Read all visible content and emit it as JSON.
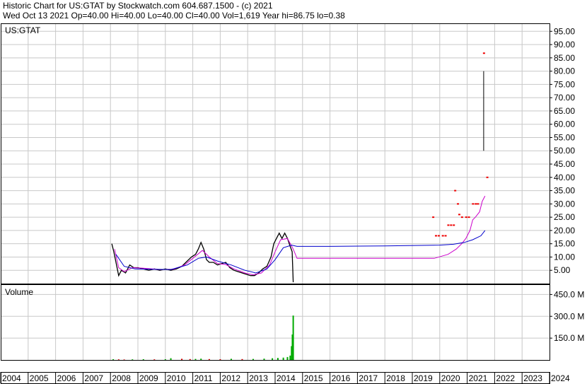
{
  "header": {
    "line1": "Historic Chart for US:GTAT by Stockwatch.com 604.687.1500 - (c) 2021",
    "line2": "Wed Oct 13 2021   Op=40.00   Hi=40.00   Lo=40.00   Cl=40.00   Vol=1,619   Year hi=86.75   lo=0.38"
  },
  "colors": {
    "price": "#000000",
    "price_dots": "#ee0000",
    "ma_short": "#cc00cc",
    "ma_long": "#0000cc",
    "vol_up": "#00aa00",
    "vol_down": "#dd0000",
    "grid": "#c8c8c8"
  },
  "chart_data": [
    {
      "type": "line",
      "panel": "price",
      "title": "US:GTAT",
      "yticks": [
        "5.00",
        "10.00",
        "15.00",
        "20.00",
        "25.00",
        "30.00",
        "35.00",
        "40.00",
        "45.00",
        "50.00",
        "55.00",
        "60.00",
        "65.00",
        "70.00",
        "75.00",
        "80.00",
        "85.00",
        "90.00",
        "95.00"
      ],
      "ylim": [
        0,
        98
      ],
      "xlim": [
        2004.0,
        2024.0
      ],
      "grid": true,
      "series": [
        {
          "role": "price",
          "points": [
            [
              2008.05,
              15
            ],
            [
              2008.12,
              12
            ],
            [
              2008.2,
              8
            ],
            [
              2008.3,
              3
            ],
            [
              2008.4,
              5
            ],
            [
              2008.55,
              4
            ],
            [
              2008.7,
              7
            ],
            [
              2008.85,
              6
            ],
            [
              2009.0,
              6
            ],
            [
              2009.2,
              5.5
            ],
            [
              2009.4,
              5
            ],
            [
              2009.6,
              5.5
            ],
            [
              2009.8,
              5
            ],
            [
              2010.0,
              5.5
            ],
            [
              2010.2,
              5
            ],
            [
              2010.4,
              5.5
            ],
            [
              2010.6,
              6.5
            ],
            [
              2010.8,
              8.5
            ],
            [
              2010.95,
              10
            ],
            [
              2011.1,
              11
            ],
            [
              2011.2,
              13
            ],
            [
              2011.3,
              15.5
            ],
            [
              2011.4,
              13
            ],
            [
              2011.5,
              9
            ],
            [
              2011.6,
              8
            ],
            [
              2011.75,
              8
            ],
            [
              2011.9,
              7
            ],
            [
              2012.05,
              7.5
            ],
            [
              2012.2,
              8
            ],
            [
              2012.35,
              6
            ],
            [
              2012.5,
              5
            ],
            [
              2012.65,
              4.5
            ],
            [
              2012.8,
              4
            ],
            [
              2012.95,
              3.5
            ],
            [
              2013.1,
              3
            ],
            [
              2013.25,
              3
            ],
            [
              2013.4,
              4
            ],
            [
              2013.55,
              5.5
            ],
            [
              2013.7,
              6.5
            ],
            [
              2013.85,
              10
            ],
            [
              2013.95,
              15
            ],
            [
              2014.05,
              17
            ],
            [
              2014.15,
              19
            ],
            [
              2014.25,
              17
            ],
            [
              2014.35,
              19
            ],
            [
              2014.45,
              17
            ],
            [
              2014.55,
              14
            ],
            [
              2014.62,
              12
            ],
            [
              2014.66,
              0.5
            ]
          ]
        },
        {
          "role": "ma_short",
          "points": [
            [
              2008.15,
              13
            ],
            [
              2008.3,
              6
            ],
            [
              2008.5,
              4.5
            ],
            [
              2008.8,
              6
            ],
            [
              2009.2,
              5.8
            ],
            [
              2009.8,
              5.3
            ],
            [
              2010.3,
              5.4
            ],
            [
              2010.7,
              7
            ],
            [
              2011.0,
              9.5
            ],
            [
              2011.35,
              12.5
            ],
            [
              2011.6,
              10
            ],
            [
              2011.9,
              7.5
            ],
            [
              2012.2,
              7.2
            ],
            [
              2012.5,
              5.5
            ],
            [
              2012.9,
              4
            ],
            [
              2013.2,
              3.3
            ],
            [
              2013.5,
              4
            ],
            [
              2013.8,
              7
            ],
            [
              2014.0,
              12
            ],
            [
              2014.2,
              16.5
            ],
            [
              2014.45,
              17
            ],
            [
              2014.66,
              13
            ],
            [
              2014.8,
              9.5
            ],
            [
              2016.0,
              9.5
            ],
            [
              2018.0,
              9.5
            ],
            [
              2019.8,
              9.5
            ],
            [
              2020.3,
              11
            ],
            [
              2020.6,
              13
            ],
            [
              2020.8,
              15
            ],
            [
              2020.95,
              17
            ],
            [
              2021.1,
              20
            ],
            [
              2021.2,
              24
            ],
            [
              2021.3,
              25
            ],
            [
              2021.45,
              27
            ],
            [
              2021.55,
              31
            ],
            [
              2021.65,
              33
            ]
          ]
        },
        {
          "role": "ma_long",
          "points": [
            [
              2008.2,
              11
            ],
            [
              2008.5,
              6.5
            ],
            [
              2008.9,
              5.5
            ],
            [
              2009.5,
              5.4
            ],
            [
              2010.2,
              5.3
            ],
            [
              2010.8,
              7
            ],
            [
              2011.2,
              9.5
            ],
            [
              2011.5,
              10
            ],
            [
              2011.9,
              8.5
            ],
            [
              2012.4,
              7
            ],
            [
              2012.9,
              5
            ],
            [
              2013.3,
              4
            ],
            [
              2013.7,
              5.5
            ],
            [
              2014.0,
              9
            ],
            [
              2014.3,
              13.5
            ],
            [
              2014.6,
              14.5
            ],
            [
              2014.8,
              14
            ],
            [
              2016.0,
              14
            ],
            [
              2018.0,
              14.2
            ],
            [
              2020.0,
              14.5
            ],
            [
              2020.5,
              14.8
            ],
            [
              2020.9,
              15.5
            ],
            [
              2021.2,
              16.5
            ],
            [
              2021.5,
              18
            ],
            [
              2021.65,
              20
            ]
          ]
        },
        {
          "role": "recent_bar",
          "points": [
            [
              2021.6,
              50
            ],
            [
              2021.6,
              80
            ]
          ]
        },
        {
          "role": "price_dots",
          "points": [
            [
              2019.75,
              25
            ],
            [
              2019.85,
              18
            ],
            [
              2019.95,
              18
            ],
            [
              2020.1,
              18
            ],
            [
              2020.2,
              18
            ],
            [
              2020.3,
              22
            ],
            [
              2020.4,
              22
            ],
            [
              2020.5,
              22
            ],
            [
              2020.55,
              35
            ],
            [
              2020.65,
              30
            ],
            [
              2020.7,
              26
            ],
            [
              2020.8,
              25
            ],
            [
              2020.95,
              25
            ],
            [
              2021.05,
              25
            ],
            [
              2021.2,
              30
            ],
            [
              2021.3,
              30
            ],
            [
              2021.38,
              30
            ],
            [
              2021.6,
              86.75
            ],
            [
              2021.72,
              40
            ]
          ]
        }
      ]
    },
    {
      "type": "bar",
      "panel": "volume",
      "title": "Volume",
      "yticks": [
        "150.0 M",
        "300.0 M",
        "450.0 M"
      ],
      "ylim": [
        0,
        520
      ],
      "grid": true,
      "series": [
        {
          "role": "volume",
          "points": [
            [
              2008.1,
              5
            ],
            [
              2008.3,
              4
            ],
            [
              2008.5,
              3
            ],
            [
              2008.8,
              4
            ],
            [
              2009.2,
              5
            ],
            [
              2009.6,
              4
            ],
            [
              2010.0,
              5
            ],
            [
              2010.2,
              12
            ],
            [
              2010.6,
              8
            ],
            [
              2010.9,
              6
            ],
            [
              2011.1,
              7
            ],
            [
              2011.3,
              9
            ],
            [
              2011.6,
              6
            ],
            [
              2012.0,
              5
            ],
            [
              2012.4,
              8
            ],
            [
              2012.8,
              6
            ],
            [
              2013.2,
              7
            ],
            [
              2013.6,
              9
            ],
            [
              2013.9,
              12
            ],
            [
              2014.1,
              14
            ],
            [
              2014.3,
              16
            ],
            [
              2014.45,
              20
            ],
            [
              2014.55,
              30
            ],
            [
              2014.6,
              95
            ],
            [
              2014.63,
              175
            ],
            [
              2014.66,
              305
            ]
          ]
        }
      ]
    },
    {
      "type": "axis",
      "panel": "years",
      "categories": [
        "2004",
        "2005",
        "2006",
        "2007",
        "2008",
        "2009",
        "2010",
        "2011",
        "2012",
        "2013",
        "2014",
        "2015",
        "2016",
        "2017",
        "2018",
        "2019",
        "2020",
        "2021",
        "2022",
        "2023",
        "2024"
      ]
    }
  ]
}
